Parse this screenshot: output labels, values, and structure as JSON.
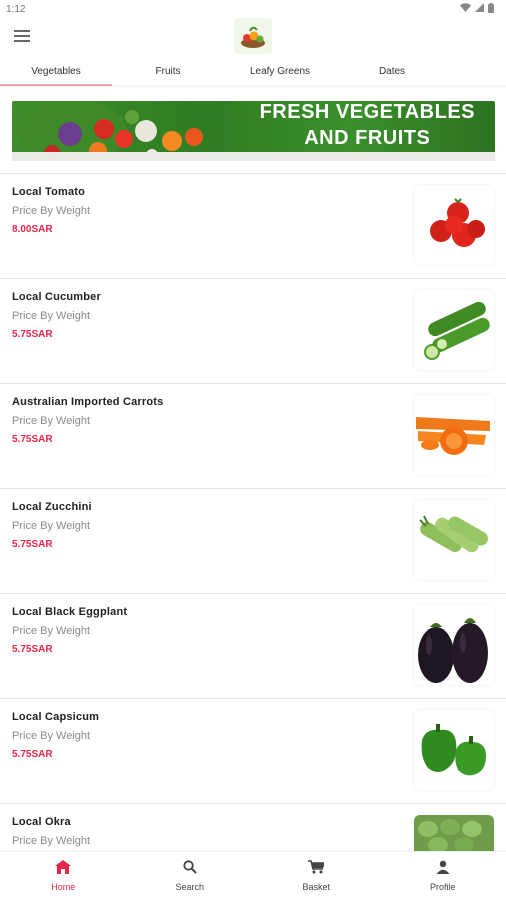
{
  "status_bar": {
    "time": "1:12"
  },
  "tabs": [
    "Vegetables",
    "Fruits",
    "Leafy Greens",
    "Dates"
  ],
  "banner": {
    "line1": "FRESH VEGETABLES",
    "line2": "AND FRUITS"
  },
  "products": [
    {
      "name": "Local Tomato",
      "subtitle": "Price By Weight",
      "price": "8.00SAR",
      "icon": "tomato-image"
    },
    {
      "name": "Local Cucumber",
      "subtitle": "Price By Weight",
      "price": "5.75SAR",
      "icon": "cucumber-image"
    },
    {
      "name": "Australian Imported Carrots",
      "subtitle": "Price By Weight",
      "price": "5.75SAR",
      "icon": "carrot-image"
    },
    {
      "name": "Local Zucchini",
      "subtitle": "Price By Weight",
      "price": "5.75SAR",
      "icon": "zucchini-image"
    },
    {
      "name": "Local Black Eggplant",
      "subtitle": "Price By Weight",
      "price": "5.75SAR",
      "icon": "eggplant-image"
    },
    {
      "name": "Local Capsicum",
      "subtitle": "Price By Weight",
      "price": "5.75SAR",
      "icon": "capsicum-image"
    },
    {
      "name": "Local Okra",
      "subtitle": "Price By Weight",
      "price": "",
      "icon": "okra-image"
    }
  ],
  "bottom_nav": [
    {
      "label": "Home",
      "icon": "home-icon"
    },
    {
      "label": "Search",
      "icon": "search-icon"
    },
    {
      "label": "Basket",
      "icon": "cart-icon"
    },
    {
      "label": "Profile",
      "icon": "profile-icon"
    }
  ],
  "colors": {
    "accent": "#e8254a",
    "banner_green": "#2f7c22"
  }
}
